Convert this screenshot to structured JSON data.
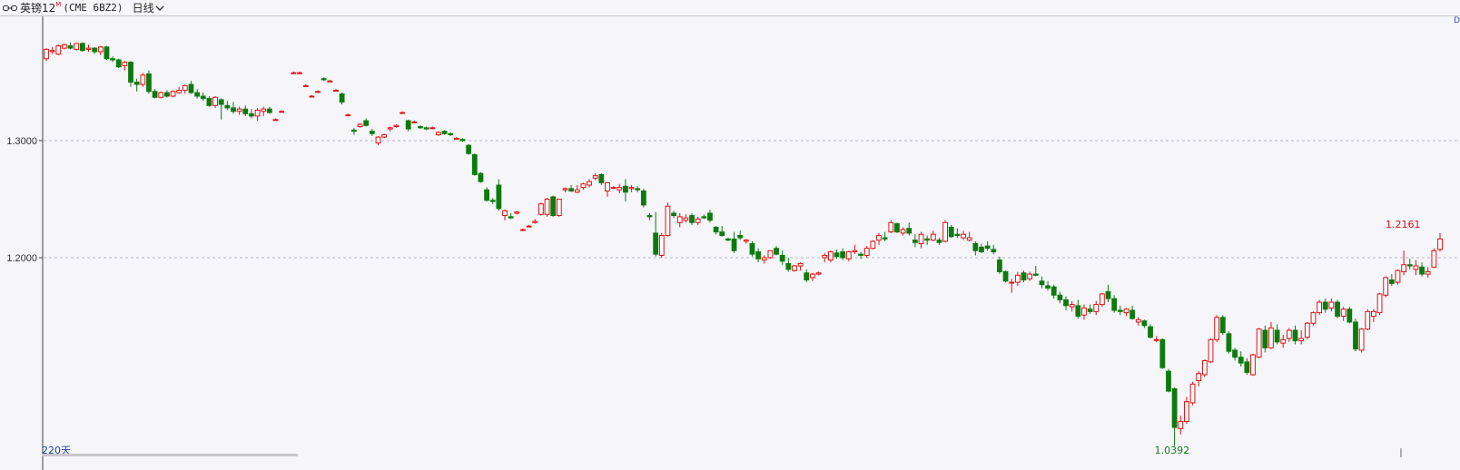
{
  "header": {
    "title": "英镑12",
    "superscript": "M",
    "code": "(CME 6BZ2)",
    "period": "日线"
  },
  "corner_label": "D",
  "colors": {
    "up": "#e01010",
    "down": "#0d7a0d",
    "grid": "#b8b8c4",
    "axis": "#444444"
  },
  "chart_data": {
    "type": "candlestick",
    "title": "英镑12 (CME 6BZ2) 日线",
    "y_ticks": [
      "1.3000",
      "1.2000"
    ],
    "ylim": [
      1.0392,
      1.4
    ],
    "grid": true,
    "day_count_label": "220天",
    "min_label": "1.0392",
    "last_label": "1.2161",
    "ohlc": [
      [
        1.37,
        1.379,
        1.368,
        1.378
      ],
      [
        1.376,
        1.38,
        1.374,
        1.377
      ],
      [
        1.374,
        1.382,
        1.373,
        1.381
      ],
      [
        1.379,
        1.383,
        1.378,
        1.382
      ],
      [
        1.381,
        1.384,
        1.378,
        1.379
      ],
      [
        1.378,
        1.383,
        1.377,
        1.383
      ],
      [
        1.383,
        1.384,
        1.376,
        1.377
      ],
      [
        1.378,
        1.382,
        1.376,
        1.379
      ],
      [
        1.379,
        1.38,
        1.374,
        1.376
      ],
      [
        1.376,
        1.381,
        1.373,
        1.38
      ],
      [
        1.38,
        1.381,
        1.369,
        1.37
      ],
      [
        1.37,
        1.372,
        1.367,
        1.369
      ],
      [
        1.369,
        1.37,
        1.362,
        1.363
      ],
      [
        1.364,
        1.368,
        1.36,
        1.367
      ],
      [
        1.367,
        1.368,
        1.346,
        1.35
      ],
      [
        1.35,
        1.353,
        1.342,
        1.348
      ],
      [
        1.348,
        1.358,
        1.346,
        1.356
      ],
      [
        1.357,
        1.36,
        1.34,
        1.342
      ],
      [
        1.342,
        1.344,
        1.336,
        1.337
      ],
      [
        1.337,
        1.342,
        1.336,
        1.341
      ],
      [
        1.341,
        1.343,
        1.337,
        1.338
      ],
      [
        1.338,
        1.343,
        1.337,
        1.342
      ],
      [
        1.341,
        1.346,
        1.34,
        1.343
      ],
      [
        1.343,
        1.348,
        1.34,
        1.347
      ],
      [
        1.348,
        1.351,
        1.34,
        1.341
      ],
      [
        1.341,
        1.344,
        1.336,
        1.338
      ],
      [
        1.338,
        1.341,
        1.334,
        1.336
      ],
      [
        1.336,
        1.338,
        1.329,
        1.33
      ],
      [
        1.33,
        1.338,
        1.328,
        1.337
      ],
      [
        1.335,
        1.336,
        1.318,
        1.331
      ],
      [
        1.33,
        1.334,
        1.326,
        1.328
      ],
      [
        1.328,
        1.333,
        1.323,
        1.325
      ],
      [
        1.325,
        1.329,
        1.322,
        1.327
      ],
      [
        1.327,
        1.33,
        1.321,
        1.323
      ],
      [
        1.323,
        1.327,
        1.319,
        1.321
      ],
      [
        1.321,
        1.328,
        1.317,
        1.326
      ],
      [
        1.325,
        1.329,
        1.321,
        1.327
      ],
      [
        1.327,
        1.329,
        1.323,
        1.324
      ],
      [
        1.318,
        1.319,
        1.317,
        1.318
      ],
      [
        1.325,
        1.326,
        1.324,
        1.325
      ],
      [
        null,
        null,
        null,
        null
      ],
      [
        1.358,
        1.359,
        1.357,
        1.358
      ],
      [
        1.358,
        1.359,
        1.357,
        1.358
      ],
      [
        1.347,
        1.348,
        1.346,
        1.347
      ],
      [
        1.338,
        1.339,
        1.337,
        1.338
      ],
      [
        1.342,
        1.343,
        1.341,
        1.342
      ],
      [
        1.353,
        1.354,
        1.351,
        1.352
      ],
      [
        1.351,
        1.352,
        1.35,
        1.351
      ],
      [
        1.343,
        1.344,
        1.342,
        1.343
      ],
      [
        1.34,
        1.341,
        1.331,
        1.333
      ],
      [
        1.322,
        1.323,
        1.321,
        1.322
      ],
      [
        1.309,
        1.311,
        1.305,
        1.308
      ],
      [
        1.312,
        1.315,
        1.311,
        1.314
      ],
      [
        1.317,
        1.319,
        1.312,
        1.313
      ],
      [
        1.308,
        1.31,
        1.304,
        1.306
      ],
      [
        1.298,
        1.304,
        1.296,
        1.303
      ],
      [
        1.303,
        1.306,
        1.302,
        1.305
      ],
      [
        1.31,
        1.312,
        1.308,
        1.311
      ],
      [
        1.312,
        1.314,
        1.311,
        1.313
      ],
      [
        1.324,
        1.325,
        1.323,
        1.324
      ],
      [
        1.317,
        1.318,
        1.308,
        1.31
      ],
      [
        1.316,
        1.317,
        1.315,
        1.316
      ],
      [
        1.312,
        1.313,
        1.31,
        1.311
      ],
      [
        1.311,
        1.312,
        1.309,
        1.31
      ],
      [
        1.311,
        1.312,
        1.31,
        1.311
      ],
      [
        1.305,
        1.308,
        1.304,
        1.307
      ],
      [
        1.308,
        1.309,
        1.305,
        1.306
      ],
      [
        1.306,
        1.307,
        1.304,
        1.305
      ],
      [
        1.302,
        1.303,
        1.301,
        1.302
      ],
      [
        1.301,
        1.302,
        1.299,
        1.3
      ],
      [
        1.296,
        1.297,
        1.288,
        1.289
      ],
      [
        1.288,
        1.289,
        1.27,
        1.271
      ],
      [
        1.272,
        1.273,
        1.264,
        1.265
      ],
      [
        1.258,
        1.26,
        1.248,
        1.249
      ],
      [
        1.249,
        1.251,
        1.246,
        1.248
      ],
      [
        1.262,
        1.267,
        1.24,
        1.242
      ],
      [
        1.236,
        1.241,
        1.232,
        1.24
      ],
      [
        1.235,
        1.238,
        1.233,
        1.234
      ],
      [
        1.238,
        1.24,
        1.237,
        1.239
      ],
      [
        1.224,
        1.225,
        1.223,
        1.224
      ],
      [
        1.227,
        1.228,
        1.226,
        1.227
      ],
      [
        1.23,
        1.233,
        1.229,
        1.231
      ],
      [
        1.237,
        1.247,
        1.236,
        1.246
      ],
      [
        1.237,
        1.251,
        1.235,
        1.25
      ],
      [
        1.252,
        1.253,
        1.235,
        1.236
      ],
      [
        1.236,
        1.25,
        1.235,
        1.25
      ],
      [
        1.258,
        1.26,
        1.256,
        1.259
      ],
      [
        1.259,
        1.262,
        1.256,
        1.257
      ],
      [
        1.256,
        1.262,
        1.255,
        1.258
      ],
      [
        1.26,
        1.264,
        1.258,
        1.263
      ],
      [
        1.262,
        1.267,
        1.26,
        1.265
      ],
      [
        1.268,
        1.272,
        1.266,
        1.27
      ],
      [
        1.271,
        1.272,
        1.262,
        1.264
      ],
      [
        1.257,
        1.264,
        1.252,
        1.264
      ],
      [
        1.26,
        1.261,
        1.259,
        1.26
      ],
      [
        1.258,
        1.263,
        1.255,
        1.26
      ],
      [
        1.261,
        1.267,
        1.248,
        1.256
      ],
      [
        1.259,
        1.262,
        1.256,
        1.26
      ],
      [
        1.259,
        1.261,
        1.256,
        1.258
      ],
      [
        1.257,
        1.259,
        1.243,
        1.245
      ],
      [
        1.236,
        1.238,
        1.232,
        1.235
      ],
      [
        1.221,
        1.239,
        1.201,
        1.203
      ],
      [
        1.202,
        1.221,
        1.2,
        1.219
      ],
      [
        1.219,
        1.247,
        1.218,
        1.244
      ],
      [
        1.238,
        1.24,
        1.234,
        1.236
      ],
      [
        1.23,
        1.238,
        1.226,
        1.235
      ],
      [
        1.232,
        1.237,
        1.23,
        1.234
      ],
      [
        1.236,
        1.238,
        1.228,
        1.23
      ],
      [
        1.23,
        1.235,
        1.228,
        1.233
      ],
      [
        1.235,
        1.237,
        1.233,
        1.234
      ],
      [
        1.238,
        1.241,
        1.23,
        1.232
      ],
      [
        1.226,
        1.227,
        1.22,
        1.222
      ],
      [
        1.222,
        1.227,
        1.218,
        1.219
      ],
      [
        1.216,
        1.217,
        1.214,
        1.215
      ],
      [
        1.216,
        1.222,
        1.204,
        1.206
      ],
      [
        1.219,
        1.223,
        1.215,
        1.217
      ],
      [
        1.214,
        1.216,
        1.212,
        1.215
      ],
      [
        1.212,
        1.214,
        1.201,
        1.203
      ],
      [
        1.205,
        1.208,
        1.196,
        1.199
      ],
      [
        1.198,
        1.202,
        1.195,
        1.2
      ],
      [
        1.2,
        1.206,
        1.199,
        1.206
      ],
      [
        1.208,
        1.21,
        1.202,
        1.203
      ],
      [
        1.202,
        1.206,
        1.194,
        1.197
      ],
      [
        1.195,
        1.2,
        1.188,
        1.19
      ],
      [
        1.189,
        1.194,
        1.188,
        1.193
      ],
      [
        1.193,
        1.196,
        1.189,
        1.195
      ],
      [
        1.187,
        1.19,
        1.179,
        1.181
      ],
      [
        1.183,
        1.187,
        1.18,
        1.186
      ],
      [
        1.186,
        1.188,
        1.185,
        1.187
      ],
      [
        1.2,
        1.204,
        1.196,
        1.202
      ],
      [
        1.198,
        1.206,
        1.196,
        1.205
      ],
      [
        1.204,
        1.207,
        1.199,
        1.201
      ],
      [
        1.205,
        1.208,
        1.198,
        1.2
      ],
      [
        1.199,
        1.206,
        1.197,
        1.205
      ],
      [
        1.205,
        1.211,
        1.203,
        1.206
      ],
      [
        1.203,
        1.205,
        1.199,
        1.202
      ],
      [
        1.202,
        1.21,
        1.2,
        1.208
      ],
      [
        1.208,
        1.215,
        1.207,
        1.214
      ],
      [
        1.215,
        1.221,
        1.211,
        1.219
      ],
      [
        1.217,
        1.222,
        1.214,
        1.216
      ],
      [
        1.222,
        1.232,
        1.221,
        1.23
      ],
      [
        1.229,
        1.23,
        1.221,
        1.222
      ],
      [
        1.221,
        1.226,
        1.219,
        1.224
      ],
      [
        1.225,
        1.23,
        1.219,
        1.221
      ],
      [
        1.215,
        1.22,
        1.209,
        1.213
      ],
      [
        1.212,
        1.222,
        1.208,
        1.22
      ],
      [
        1.216,
        1.219,
        1.211,
        1.215
      ],
      [
        1.215,
        1.223,
        1.214,
        1.22
      ],
      [
        1.215,
        1.217,
        1.211,
        1.213
      ],
      [
        1.214,
        1.232,
        1.213,
        1.23
      ],
      [
        1.226,
        1.228,
        1.217,
        1.218
      ],
      [
        1.22,
        1.225,
        1.217,
        1.219
      ],
      [
        1.217,
        1.223,
        1.215,
        1.22
      ],
      [
        1.215,
        1.222,
        1.214,
        1.217
      ],
      [
        1.212,
        1.214,
        1.202,
        1.206
      ],
      [
        1.209,
        1.212,
        1.204,
        1.205
      ],
      [
        1.21,
        1.214,
        1.206,
        1.208
      ],
      [
        1.207,
        1.211,
        1.203,
        1.205
      ],
      [
        1.198,
        1.201,
        1.186,
        1.188
      ],
      [
        1.188,
        1.189,
        1.179,
        1.18
      ],
      [
        1.179,
        1.182,
        1.17,
        1.179
      ],
      [
        1.179,
        1.188,
        1.176,
        1.185
      ],
      [
        1.187,
        1.189,
        1.179,
        1.181
      ],
      [
        1.182,
        1.188,
        1.18,
        1.186
      ],
      [
        1.186,
        1.193,
        1.184,
        1.185
      ],
      [
        1.18,
        1.184,
        1.174,
        1.177
      ],
      [
        1.176,
        1.18,
        1.172,
        1.174
      ],
      [
        1.175,
        1.177,
        1.165,
        1.168
      ],
      [
        1.168,
        1.171,
        1.161,
        1.164
      ],
      [
        1.164,
        1.167,
        1.155,
        1.159
      ],
      [
        1.158,
        1.163,
        1.154,
        1.16
      ],
      [
        1.159,
        1.164,
        1.148,
        1.15
      ],
      [
        1.151,
        1.16,
        1.147,
        1.157
      ],
      [
        1.156,
        1.16,
        1.152,
        1.154
      ],
      [
        1.154,
        1.163,
        1.151,
        1.16
      ],
      [
        1.16,
        1.17,
        1.158,
        1.169
      ],
      [
        1.171,
        1.177,
        1.162,
        1.165
      ],
      [
        1.165,
        1.168,
        1.153,
        1.155
      ],
      [
        1.155,
        1.159,
        1.151,
        1.154
      ],
      [
        1.153,
        1.157,
        1.15,
        1.156
      ],
      [
        1.155,
        1.159,
        1.147,
        1.148
      ],
      [
        1.145,
        1.149,
        1.142,
        1.147
      ],
      [
        1.146,
        1.147,
        1.14,
        1.142
      ],
      [
        1.141,
        1.143,
        1.131,
        1.132
      ],
      [
        1.13,
        1.133,
        1.128,
        1.13
      ],
      [
        1.13,
        1.131,
        1.105,
        1.106
      ],
      [
        1.103,
        1.105,
        1.085,
        1.086
      ],
      [
        1.088,
        1.089,
        1.0392,
        1.055
      ],
      [
        1.054,
        1.065,
        1.049,
        1.06
      ],
      [
        1.06,
        1.081,
        1.058,
        1.077
      ],
      [
        1.076,
        1.094,
        1.074,
        1.092
      ],
      [
        1.095,
        1.103,
        1.09,
        1.101
      ],
      [
        1.1,
        1.113,
        1.098,
        1.112
      ],
      [
        1.111,
        1.131,
        1.11,
        1.13
      ],
      [
        1.13,
        1.151,
        1.128,
        1.149
      ],
      [
        1.149,
        1.151,
        1.134,
        1.136
      ],
      [
        1.135,
        1.137,
        1.118,
        1.12
      ],
      [
        1.121,
        1.123,
        1.112,
        1.115
      ],
      [
        1.115,
        1.12,
        1.107,
        1.11
      ],
      [
        1.111,
        1.114,
        1.1,
        1.102
      ],
      [
        1.1,
        1.118,
        1.099,
        1.117
      ],
      [
        1.115,
        1.14,
        1.114,
        1.139
      ],
      [
        1.138,
        1.142,
        1.119,
        1.123
      ],
      [
        1.123,
        1.145,
        1.122,
        1.14
      ],
      [
        1.138,
        1.143,
        1.126,
        1.128
      ],
      [
        1.127,
        1.134,
        1.123,
        1.13
      ],
      [
        1.131,
        1.14,
        1.128,
        1.138
      ],
      [
        1.138,
        1.142,
        1.126,
        1.129
      ],
      [
        1.129,
        1.138,
        1.126,
        1.131
      ],
      [
        1.132,
        1.145,
        1.13,
        1.144
      ],
      [
        1.144,
        1.154,
        1.142,
        1.153
      ],
      [
        1.153,
        1.164,
        1.151,
        1.162
      ],
      [
        1.162,
        1.165,
        1.153,
        1.156
      ],
      [
        1.157,
        1.165,
        1.154,
        1.162
      ],
      [
        1.162,
        1.164,
        1.148,
        1.15
      ],
      [
        1.15,
        1.158,
        1.146,
        1.156
      ],
      [
        1.156,
        1.158,
        1.144,
        1.145
      ],
      [
        1.145,
        1.148,
        1.12,
        1.122
      ],
      [
        1.121,
        1.14,
        1.119,
        1.139
      ],
      [
        1.139,
        1.156,
        1.138,
        1.154
      ],
      [
        1.15,
        1.156,
        1.145,
        1.154
      ],
      [
        1.153,
        1.17,
        1.151,
        1.169
      ],
      [
        1.168,
        1.184,
        1.166,
        1.183
      ],
      [
        1.181,
        1.186,
        1.176,
        1.178
      ],
      [
        1.179,
        1.19,
        1.177,
        1.189
      ],
      [
        1.188,
        1.206,
        1.185,
        1.194
      ],
      [
        1.194,
        1.199,
        1.19,
        1.193
      ],
      [
        1.19,
        1.198,
        1.185,
        1.193
      ],
      [
        1.192,
        1.196,
        1.184,
        1.186
      ],
      [
        1.186,
        1.192,
        1.183,
        1.188
      ],
      [
        1.192,
        1.208,
        1.191,
        1.206
      ],
      [
        1.207,
        1.221,
        1.205,
        1.216
      ]
    ]
  }
}
